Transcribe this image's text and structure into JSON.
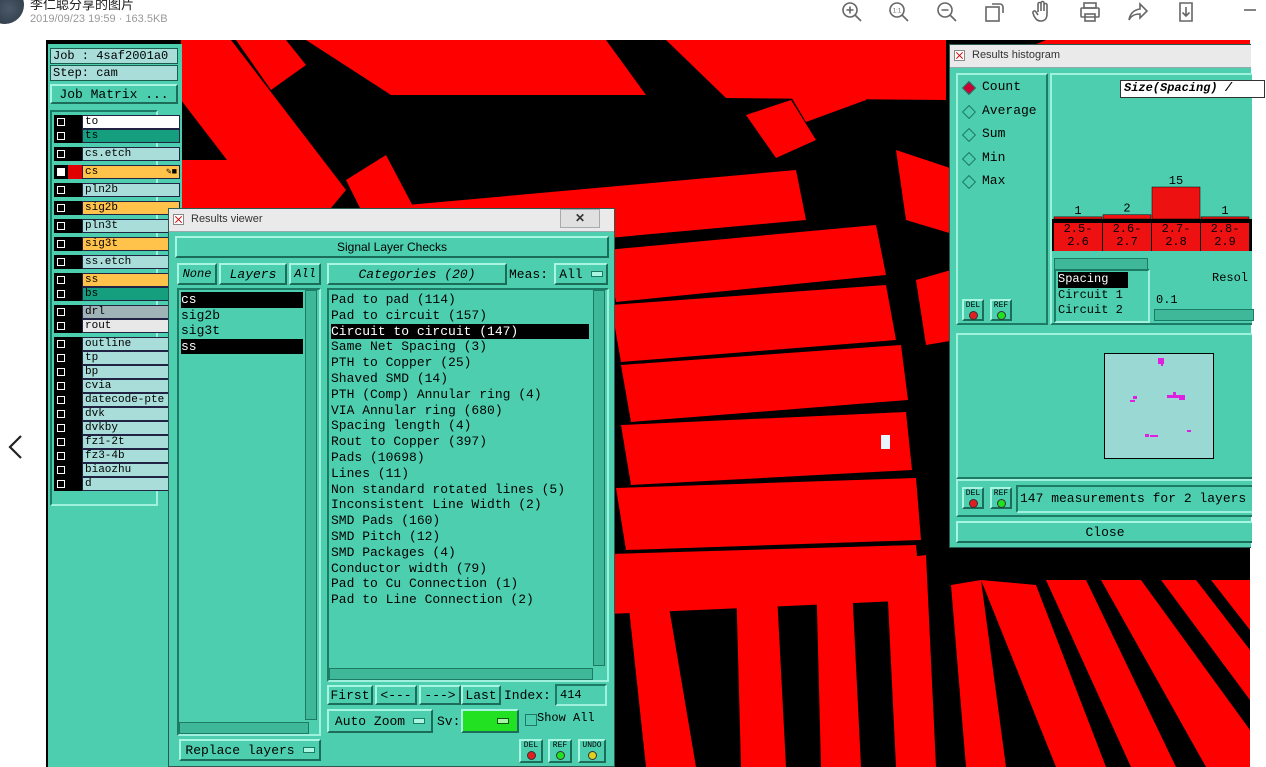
{
  "viewer": {
    "title": "李仁聪分享的图片",
    "meta": "2019/09/23 19:59 · 163.5KB",
    "tools": [
      "zoom-in-icon",
      "actual-size-icon",
      "zoom-out-icon",
      "rotate-icon",
      "hand-icon",
      "print-icon",
      "share-icon",
      "download-icon"
    ],
    "actual_size_label": "1:1"
  },
  "job": {
    "job_label": "Job : 4saf2001a0",
    "step_label": "Step: cam",
    "matrix_button": "Job Matrix ..."
  },
  "layers": [
    {
      "name": "to",
      "bg": "#ffffff",
      "cell": "#000000"
    },
    {
      "name": "ts",
      "bg": "#159f7e",
      "cell": "#000000"
    },
    {
      "name": "cs.etch",
      "bg": "#a8ddd9",
      "cell": "#000000"
    },
    {
      "name": "cs",
      "bg": "#ffc24a",
      "cell": "#e00000",
      "selected": true,
      "flag": "✎■"
    },
    {
      "name": "pln2b",
      "bg": "#a8ddd9",
      "cell": "#000000"
    },
    {
      "name": "sig2b",
      "bg": "#ffc24a",
      "cell": "#000000"
    },
    {
      "name": "pln3t",
      "bg": "#a8ddd9",
      "cell": "#000000"
    },
    {
      "name": "sig3t",
      "bg": "#ffc24a",
      "cell": "#000000"
    },
    {
      "name": "ss.etch",
      "bg": "#a8ddd9",
      "cell": "#000000"
    },
    {
      "name": "ss",
      "bg": "#ffc24a",
      "cell": "#000000",
      "flag": "✎"
    },
    {
      "name": "bs",
      "bg": "#159f7e",
      "cell": "#000000"
    },
    {
      "name": "drl",
      "bg": "#a0b4b8",
      "cell": "#000000"
    },
    {
      "name": "rout",
      "bg": "#e8e8e8",
      "cell": "#000000"
    },
    {
      "name": "outline",
      "bg": "#a8ddd9",
      "cell": "#000000"
    },
    {
      "name": "tp",
      "bg": "#a8ddd9",
      "cell": "#000000"
    },
    {
      "name": "bp",
      "bg": "#a8ddd9",
      "cell": "#000000"
    },
    {
      "name": "cvia",
      "bg": "#a8ddd9",
      "cell": "#000000"
    },
    {
      "name": "datecode-pte",
      "bg": "#a8ddd9",
      "cell": "#000000"
    },
    {
      "name": "dvk",
      "bg": "#a8ddd9",
      "cell": "#000000"
    },
    {
      "name": "dvkby",
      "bg": "#a8ddd9",
      "cell": "#000000"
    },
    {
      "name": "fz1-2t",
      "bg": "#a8ddd9",
      "cell": "#000000"
    },
    {
      "name": "fz3-4b",
      "bg": "#a8ddd9",
      "cell": "#000000"
    },
    {
      "name": "biaozhu",
      "bg": "#a8ddd9",
      "cell": "#000000"
    },
    {
      "name": "d",
      "bg": "#a8ddd9",
      "cell": "#000000"
    }
  ],
  "results_viewer": {
    "title": "Results viewer",
    "close_glyph": "✕",
    "header": "Signal Layer Checks",
    "none_btn": "None",
    "layers_btn": "Layers",
    "all_btn": "All",
    "layer_items": [
      {
        "label": "cs",
        "selected": true
      },
      {
        "label": "sig2b",
        "selected": false
      },
      {
        "label": "sig3t",
        "selected": false
      },
      {
        "label": "ss",
        "selected": true
      }
    ],
    "categories_btn": "Categories (20)",
    "meas_label": "Meas:",
    "meas_value": "All",
    "categories": [
      {
        "label": "Pad to pad (114)"
      },
      {
        "label": "Pad to circuit (157)"
      },
      {
        "label": "Circuit to circuit (147)",
        "selected": true
      },
      {
        "label": "Same Net Spacing (3)"
      },
      {
        "label": "PTH to Copper (25)"
      },
      {
        "label": "Shaved SMD (14)"
      },
      {
        "label": "PTH (Comp) Annular ring (4)"
      },
      {
        "label": "VIA Annular ring (680)"
      },
      {
        "label": "Spacing length (4)"
      },
      {
        "label": "Rout to Copper (397)"
      },
      {
        "label": "Pads (10698)"
      },
      {
        "label": "Lines (11)"
      },
      {
        "label": "Non standard rotated lines (5)"
      },
      {
        "label": "Inconsistent Line Width (2)"
      },
      {
        "label": "SMD Pads (160)"
      },
      {
        "label": "SMD Pitch (12)"
      },
      {
        "label": "SMD Packages (4)"
      },
      {
        "label": "Conductor width (79)"
      },
      {
        "label": "Pad to Cu Connection (1)"
      },
      {
        "label": "Pad to Line Connection (2)"
      }
    ],
    "first_btn": "First",
    "prev_btn": "<---",
    "next_btn": "--->",
    "last_btn": "Last",
    "index_label": "Index:",
    "index_value": "414",
    "auto_zoom": "Auto Zoom",
    "sv_label": "Sv:",
    "show_all": "Show All",
    "replace_layers": "Replace layers",
    "del_btn": "DEL",
    "ref_btn": "REF",
    "undo_btn": "UNDO"
  },
  "histogram": {
    "title": "Results histogram",
    "modes": [
      {
        "label": "Count",
        "on": true
      },
      {
        "label": "Average",
        "on": false
      },
      {
        "label": "Sum",
        "on": false
      },
      {
        "label": "Min",
        "on": false
      },
      {
        "label": "Max",
        "on": false
      }
    ],
    "chart_title": "Size(Spacing) /",
    "bins": [
      "2.5-\n2.6",
      "2.6-\n2.7",
      "2.7-\n2.8",
      "2.8-\n2.9"
    ],
    "counts": [
      1,
      2,
      15,
      1
    ],
    "measure_list": [
      {
        "label": "Spacing",
        "selected": true
      },
      {
        "label": "Circuit 1",
        "selected": false
      },
      {
        "label": "Circuit 2",
        "selected": false
      }
    ],
    "resol_label": "Resol",
    "resol_value": "0.1",
    "status": "147 measurements for 2 layers",
    "close_btn": "Close",
    "del_btn": "DEL",
    "ref_btn": "REF"
  },
  "colors": {
    "panel": "#4dcfaf",
    "copper": "#ff0000",
    "canvas": "#000000",
    "marker": "#e020e0"
  }
}
